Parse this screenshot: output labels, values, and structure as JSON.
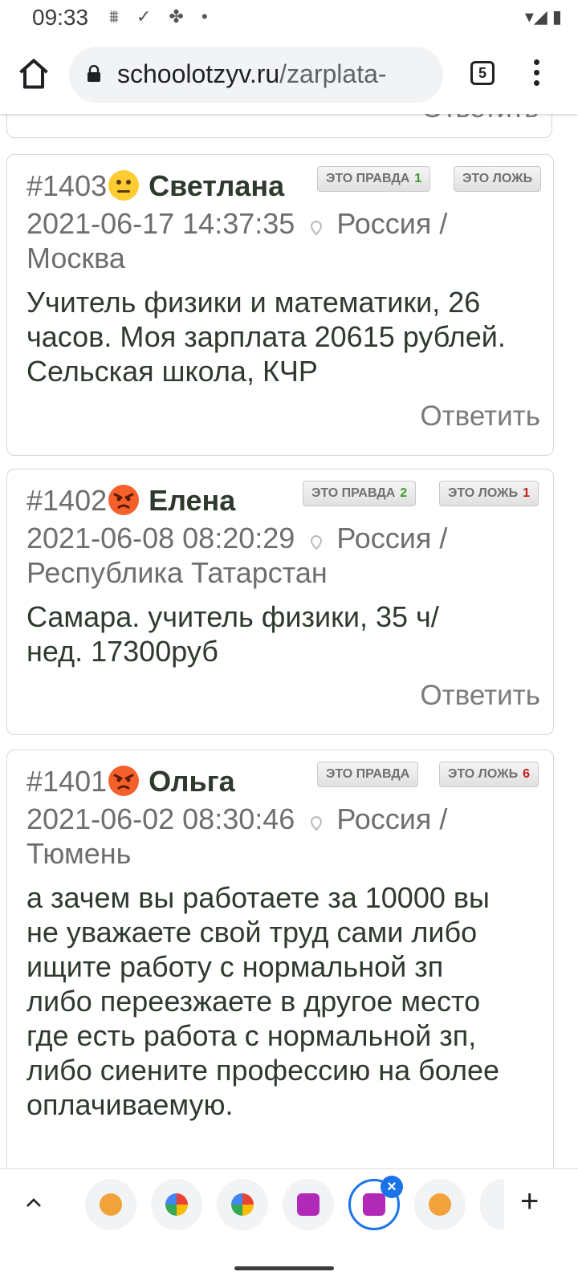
{
  "status_bar": {
    "time": "09:33",
    "left_icons": "⩩ ✓ ✤ •",
    "right_icons": "▾◢ ▮"
  },
  "browser": {
    "url_domain": "schoolotzyv.ru",
    "url_path": "/zarplata-",
    "tab_count": "5"
  },
  "prev_card": {
    "reply": "Ответить"
  },
  "comments": [
    {
      "number": "#1403",
      "emoji": "neutral-face-icon",
      "name": "Светлана",
      "datetime": "2021-06-17 14:37:35",
      "location": "Россия / Москва",
      "text": "Учитель физики и математики, 26 часов. Моя зарплата 20615 рублей. Сельская школа, КЧР",
      "true_label": "ЭТО ПРАВДА",
      "true_count": "1",
      "false_label": "ЭТО ЛОЖЬ",
      "false_count": "",
      "reply": "Ответить"
    },
    {
      "number": "#1402",
      "emoji": "angry-face-icon",
      "name": "Елена",
      "datetime": "2021-06-08 08:20:29",
      "location": "Россия / Республика Татарстан",
      "text": "Самара. учитель физики, 35 ч/нед. 17300руб",
      "true_label": "ЭТО ПРАВДА",
      "true_count": "2",
      "false_label": "ЭТО ЛОЖЬ",
      "false_count": "1",
      "reply": "Ответить"
    },
    {
      "number": "#1401",
      "emoji": "angry-face-icon",
      "name": "Ольга",
      "datetime": "2021-06-02 08:30:46",
      "location": "Россия / Тюмень",
      "text": "а зачем вы работаете за 10000 вы не уважаете свой труд сами либо ищите работу с нормальной зп либо переезжаете в другое место где есть работа с нормальной зп, либо сиените профессию на более оплачиваемую.",
      "true_label": "ЭТО ПРАВДА",
      "true_count": "",
      "false_label": "ЭТО ЛОЖЬ",
      "false_count": "6",
      "reply": "Ответить"
    }
  ],
  "tab_strip": {
    "close_glyph": "×",
    "plus_glyph": "+"
  },
  "colors": {
    "accent": "#1a73e8",
    "green": "#3c9c2a",
    "red": "#c0201a"
  }
}
